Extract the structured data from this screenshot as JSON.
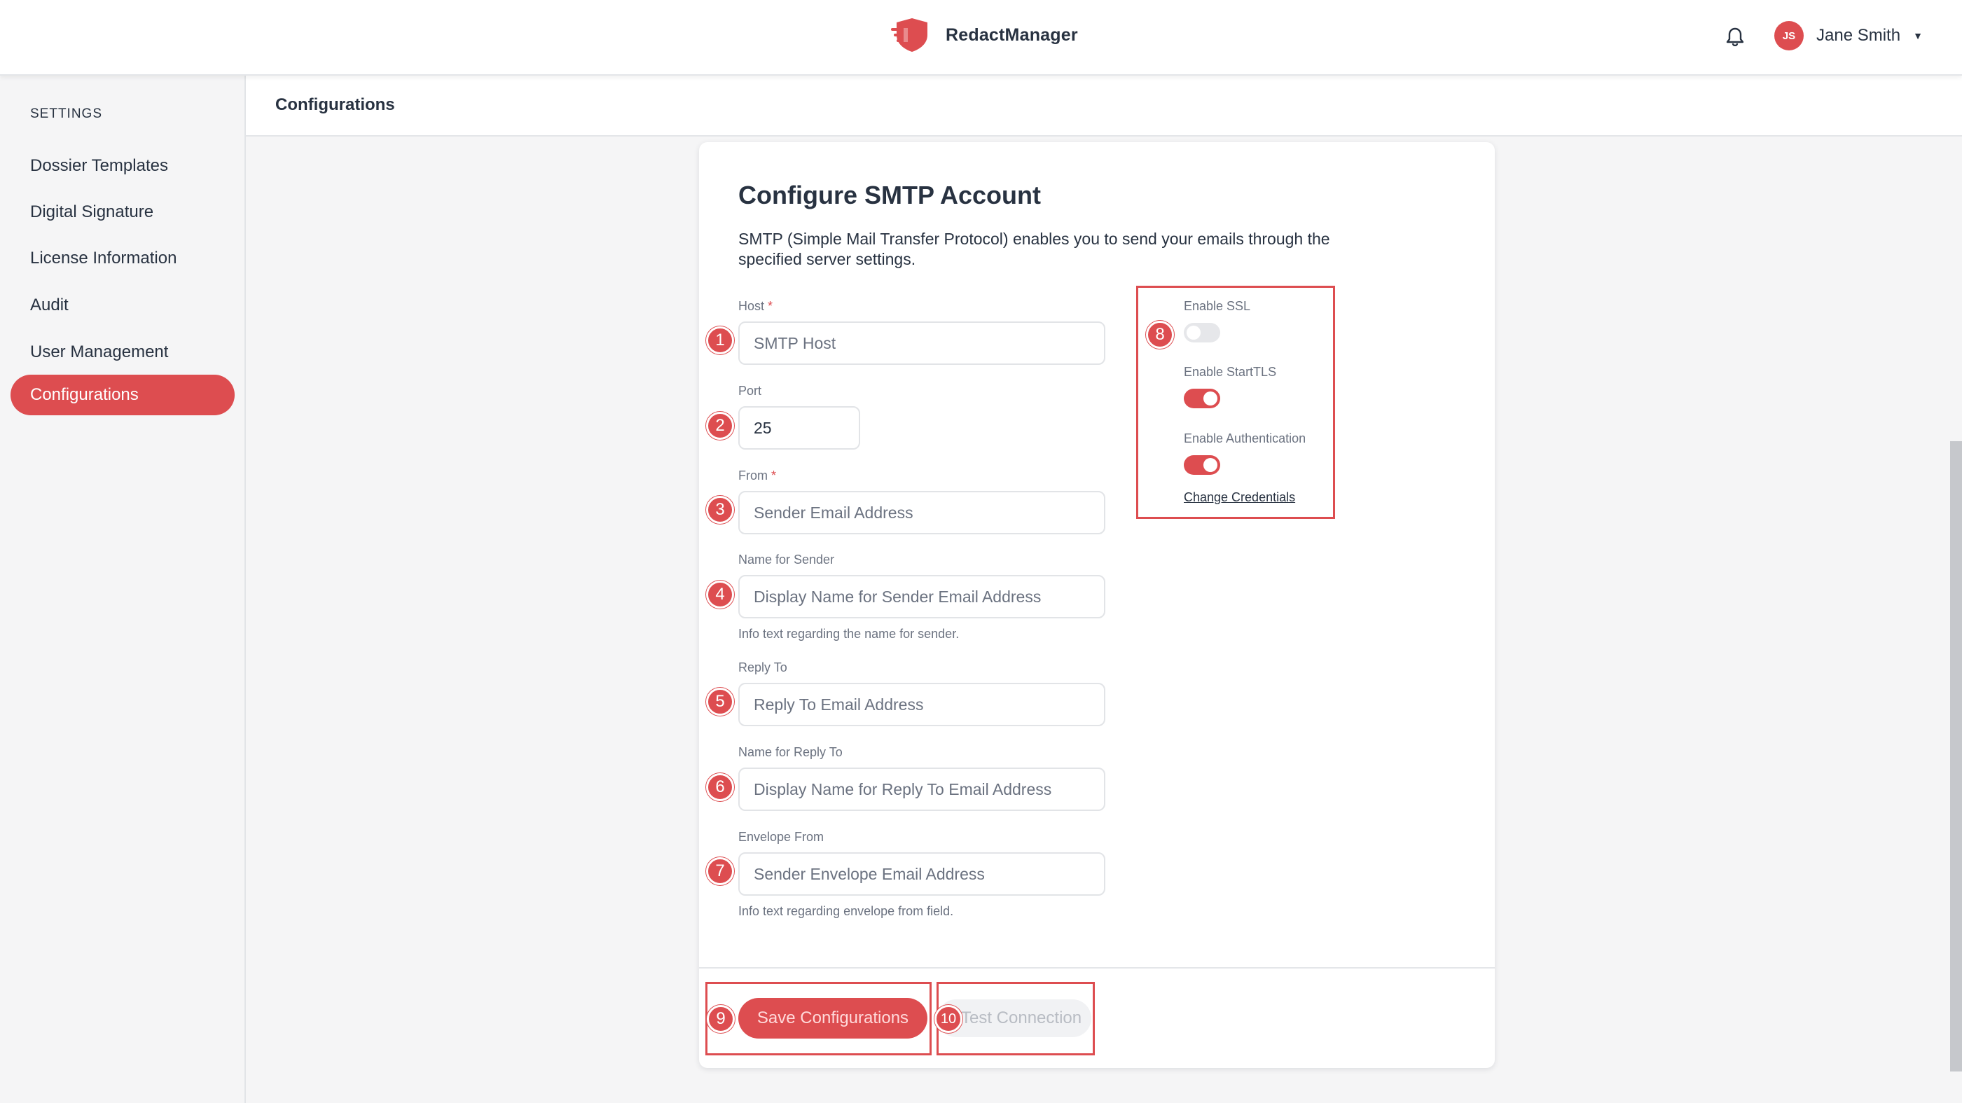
{
  "header": {
    "app_name": "RedactManager",
    "user": {
      "initials": "JS",
      "name": "Jane Smith"
    },
    "icons": {
      "logo": "shield-logo-icon",
      "notifications": "bell-icon",
      "user_menu": "caret-down-icon"
    }
  },
  "sidebar": {
    "heading": "SETTINGS",
    "items": [
      {
        "label": "Dossier Templates",
        "active": false
      },
      {
        "label": "Digital Signature",
        "active": false
      },
      {
        "label": "License Information",
        "active": false
      },
      {
        "label": "Audit",
        "active": false
      },
      {
        "label": "User Management",
        "active": false
      },
      {
        "label": "Configurations",
        "active": true
      }
    ]
  },
  "breadcrumb": {
    "current": "Configurations"
  },
  "form": {
    "title": "Configure SMTP Account",
    "description": "SMTP (Simple Mail Transfer Protocol) enables you to send your emails through the specified server settings.",
    "fields": {
      "host": {
        "label": "Host",
        "required": "*",
        "placeholder": "SMTP Host",
        "value": ""
      },
      "port": {
        "label": "Port",
        "value": "25"
      },
      "from": {
        "label": "From",
        "required": "*",
        "placeholder": "Sender Email Address",
        "value": ""
      },
      "sender_name": {
        "label": "Name for Sender",
        "placeholder": "Display Name for Sender Email Address",
        "hint": "Info text regarding the name for sender.",
        "value": ""
      },
      "reply_to": {
        "label": "Reply To",
        "placeholder": "Reply To Email Address",
        "value": ""
      },
      "reply_to_name": {
        "label": "Name for Reply To",
        "placeholder": "Display Name for Reply To Email Address",
        "value": ""
      },
      "envelope_from": {
        "label": "Envelope From",
        "placeholder": "Sender Envelope Email Address",
        "hint": "Info text regarding envelope from field.",
        "value": ""
      }
    },
    "toggles": {
      "ssl": {
        "label": "Enable SSL",
        "enabled": false
      },
      "starttls": {
        "label": "Enable StartTLS",
        "enabled": true
      },
      "auth": {
        "label": "Enable Authentication",
        "enabled": true
      }
    },
    "change_credentials": "Change Credentials",
    "buttons": {
      "save": "Save Configurations",
      "test": "Test Connection"
    }
  },
  "annotations": [
    "1",
    "2",
    "3",
    "4",
    "5",
    "6",
    "7",
    "8",
    "9",
    "10"
  ],
  "colors": {
    "accent": "#dd4d50",
    "text": "#283241",
    "muted": "#6b7280",
    "background": "#f5f5f6"
  }
}
